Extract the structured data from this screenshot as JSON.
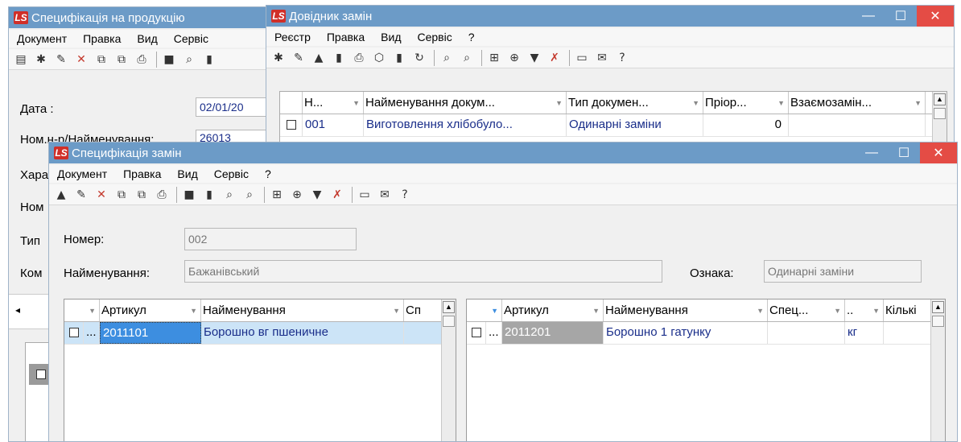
{
  "spec_window": {
    "title": "Специфікація на продукцію",
    "menu": [
      "Документ",
      "Правка",
      "Вид",
      "Сервіс"
    ],
    "fields": {
      "date_label": "Дата :",
      "date_value": "02/01/20",
      "number_label": "Ном.н-р/Найменування:",
      "number_value": "26013",
      "char_label": "Хара",
      "nom_label": "Ном",
      "type_label": "Тип",
      "kom_label": "Ком"
    }
  },
  "dovidnyk_window": {
    "title": "Довідник замін",
    "menu": [
      "Реєстр",
      "Правка",
      "Вид",
      "Сервіс",
      "?"
    ],
    "columns": [
      "Н...",
      "Найменування докум...",
      "Тип докумен...",
      "Пріор...",
      "Взаємозамін..."
    ],
    "rows": [
      {
        "num": "001",
        "name": "Виготовлення хлібобуло...",
        "type": "Одинарні заміни",
        "priority": "0",
        "mutual": ""
      }
    ]
  },
  "zamin_window": {
    "title": "Специфікація замін",
    "menu": [
      "Документ",
      "Правка",
      "Вид",
      "Сервіс",
      "?"
    ],
    "number_label": "Номер:",
    "number_value": "002",
    "name_label": "Найменування:",
    "name_value": "Бажанівський",
    "sign_label": "Ознака:",
    "sign_value": "Одинарні заміни",
    "left_grid": {
      "columns": [
        "Артикул",
        "Найменування",
        "Сп"
      ],
      "rows": [
        {
          "dots": "...",
          "article": "2011101",
          "name": "Борошно вг пшеничне"
        }
      ]
    },
    "right_grid": {
      "columns": [
        "Артикул",
        "Найменування",
        "Спец...",
        "..",
        "Кількі"
      ],
      "rows": [
        {
          "dots": "...",
          "article": "2011201",
          "name": "Борошно 1 гатунку",
          "spec": "",
          "unit": "кг"
        }
      ]
    }
  },
  "colors": {
    "title_bar": "#6c9bc7",
    "close_button": "#e44c45",
    "logo_red": "#d02f28",
    "selection": "#cce4f7",
    "link_text": "#1a2e8a"
  }
}
